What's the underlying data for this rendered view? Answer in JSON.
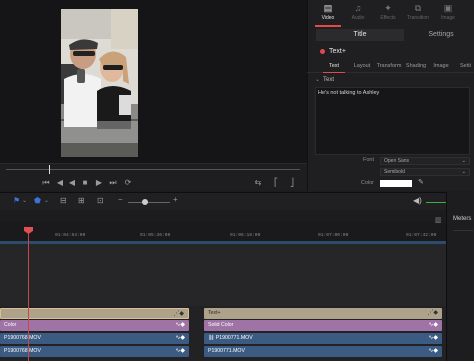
{
  "inspector": {
    "panel_tabs": [
      {
        "label": "Video",
        "icon": "film-icon",
        "active": true
      },
      {
        "label": "Audio",
        "icon": "music-note-icon",
        "active": false
      },
      {
        "label": "Effects",
        "icon": "effects-icon",
        "active": false
      },
      {
        "label": "Transition",
        "icon": "transition-icon",
        "active": false
      },
      {
        "label": "Image",
        "icon": "image-icon",
        "active": false
      }
    ],
    "sub_tabs": [
      {
        "label": "Title",
        "active": true
      },
      {
        "label": "Settings",
        "active": false
      }
    ],
    "title_name": "Text+",
    "text_tabs": [
      "Text",
      "Layout",
      "Transform",
      "Shading",
      "Image",
      "Setti"
    ],
    "section_label": "Text",
    "text_content": "He's not talking to Ashley",
    "font_label": "Font",
    "font_value": "Open Sans",
    "style_value": "Semibold",
    "color_label": "Color",
    "color_value": "#ffffff"
  },
  "timeline": {
    "timecodes": [
      "01:04:54:00",
      "01:05:36:00",
      "01:06:18:00",
      "01:07:00:00",
      "01:07:42:00"
    ],
    "tracks": {
      "left": [
        {
          "label": "",
          "kind": "text"
        },
        {
          "label": "Color",
          "kind": "solid"
        },
        {
          "label": "P1900768.MOV",
          "kind": "video"
        },
        {
          "label": "P1900768.MOV",
          "kind": "video"
        }
      ],
      "right": [
        {
          "label": "Text+",
          "kind": "text"
        },
        {
          "label": "Solid Color",
          "kind": "solid"
        },
        {
          "label": "P1900771.MOV",
          "kind": "video"
        },
        {
          "label": "P1900771.MOV",
          "kind": "video"
        }
      ]
    }
  },
  "meters": {
    "label": "Meters"
  },
  "colors": {
    "accent_red": "#e04a4a",
    "playhead": "#c8484a",
    "text_clip": "#aea28a",
    "solid_clip": "#a073a7",
    "video_clip": "#3b5b82",
    "volume_green": "#3fae43"
  }
}
